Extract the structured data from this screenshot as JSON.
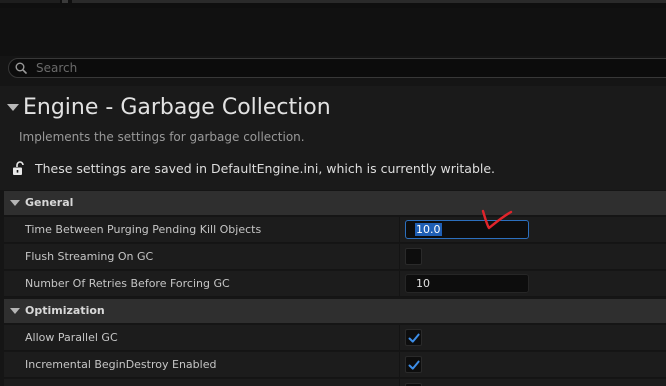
{
  "search": {
    "placeholder": "Search"
  },
  "header": {
    "title": "Engine - Garbage Collection",
    "description": "Implements the settings for garbage collection.",
    "config_note": "These settings are saved in DefaultEngine.ini, which is currently writable."
  },
  "categories": [
    {
      "label": "General",
      "properties": [
        {
          "label": "Time Between Purging Pending Kill Objects",
          "type": "number",
          "value": "10.0"
        },
        {
          "label": "Flush Streaming On GC",
          "type": "checkbox",
          "checked": false
        },
        {
          "label": "Number Of Retries Before Forcing GC",
          "type": "number",
          "value": "10"
        }
      ]
    },
    {
      "label": "Optimization",
      "properties": [
        {
          "label": "Allow Parallel GC",
          "type": "checkbox",
          "checked": true
        },
        {
          "label": "Incremental BeginDestroy Enabled",
          "type": "checkbox",
          "checked": true
        }
      ]
    }
  ],
  "colors": {
    "background": "#151515",
    "category_bg": "#2f2f2f",
    "row_bg": "#1c1c1c",
    "accent_blue": "#2c6fbd",
    "annotation_red": "#e0242b"
  },
  "icons": {
    "search": "search-icon",
    "lock": "unlock-icon",
    "expand": "chevron-down-icon",
    "check": "checkmark-icon"
  }
}
